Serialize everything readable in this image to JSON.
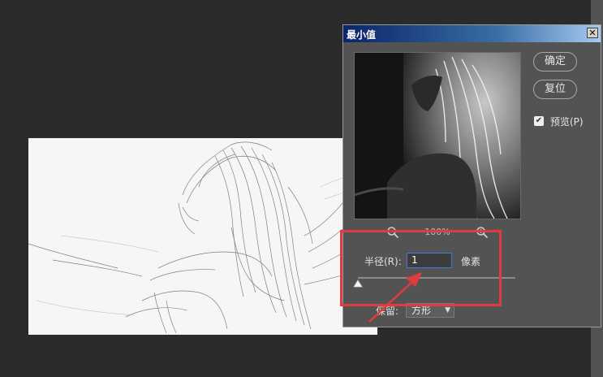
{
  "dialog": {
    "title": "最小值",
    "close_glyph": "✕",
    "ok_label": "确定",
    "reset_label": "复位",
    "preview_label": "预览(P)",
    "preview_checked": true,
    "zoom_percent": "100%",
    "radius_label": "半径(R):",
    "radius_value": "1",
    "radius_unit": "像素",
    "preserve_label": "保留:",
    "preserve_value": "方形"
  },
  "annotation": {
    "highlight_color": "#e23b3b"
  },
  "icons": [
    "close-icon",
    "zoom-out-icon",
    "zoom-in-icon",
    "checkbox-check-icon",
    "slider-thumb-icon",
    "chevron-down-icon",
    "red-arrow-icon"
  ]
}
